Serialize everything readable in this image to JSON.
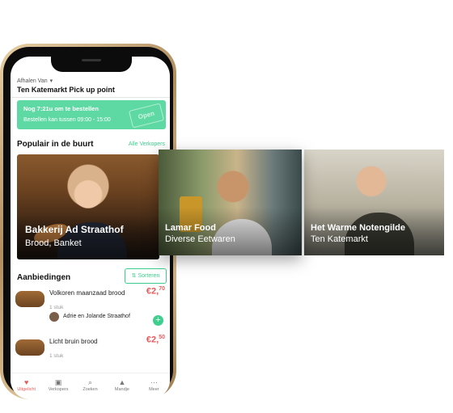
{
  "header": {
    "pickup_label": "Afhalen Van",
    "pickup_location": "Ten Katemarkt Pick up point"
  },
  "banner": {
    "countdown": "Nog 7:21u om te bestellen",
    "order_window": "Bestellen kan tussen 09:00 - 15:00",
    "sign_text": "Open"
  },
  "popular": {
    "title": "Populair in de buurt",
    "all_sellers_link": "Alle Verkopers"
  },
  "vendor_cards": [
    {
      "name": "Bakkerij Ad Straathof",
      "category": "Brood, Banket"
    },
    {
      "name": "Lamar Food",
      "category": "Diverse Eetwaren"
    },
    {
      "name": "Het Warme Notengilde",
      "category": "Ten Katemarkt"
    }
  ],
  "offers": {
    "title": "Aanbiedingen",
    "sort_label": "Sorteren",
    "items": [
      {
        "name": "Volkoren maanzaad brood",
        "price_main": "€2,",
        "price_cents": "70",
        "unit": "1 stuk",
        "seller": "Adrie en Jolande Straathof"
      },
      {
        "name": "Licht bruin brood",
        "price_main": "€2,",
        "price_cents": "50",
        "unit": "1 stuk"
      }
    ]
  },
  "tabbar": [
    {
      "label": "Uitgelicht",
      "icon": "heart-icon"
    },
    {
      "label": "Verkopers",
      "icon": "store-icon"
    },
    {
      "label": "Zoeken",
      "icon": "search-icon"
    },
    {
      "label": "Mandje",
      "icon": "basket-icon"
    },
    {
      "label": "Meer",
      "icon": "more-icon"
    }
  ],
  "colors": {
    "accent": "#3ecf8e",
    "price": "#e85a5a",
    "banner": "#5fd9a3"
  }
}
